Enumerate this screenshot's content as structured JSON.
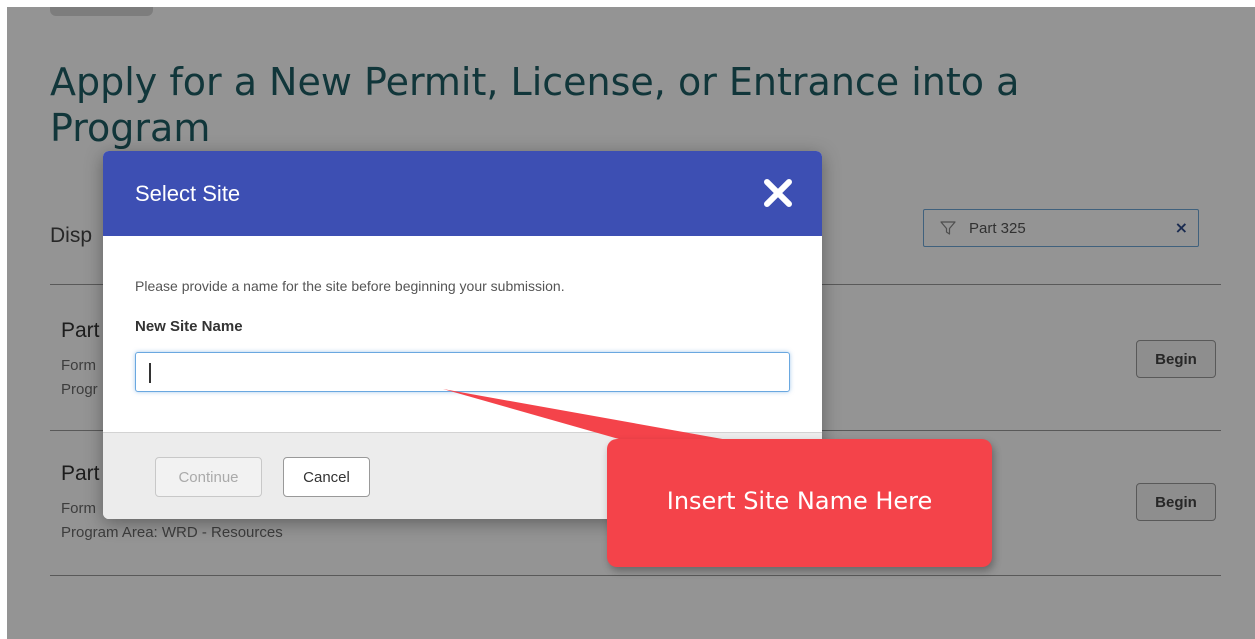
{
  "page": {
    "title": "Apply for a New Permit, License, or Entrance into a Program",
    "display_label": "Disp"
  },
  "filter": {
    "value": "Part 325",
    "clear_label": "×"
  },
  "rows": [
    {
      "title": "Part",
      "meta_lines": [
        "Form",
        "Progr"
      ],
      "button_label": "Begin"
    },
    {
      "title": "Part",
      "meta_lines": [
        "Form",
        "Program Area: WRD - Resources"
      ],
      "button_label": "Begin"
    }
  ],
  "modal": {
    "title": "Select Site",
    "close_icon": "close-icon",
    "instruction": "Please provide a name for the site before beginning your submission.",
    "field_label": "New Site Name",
    "input_value": "",
    "continue_label": "Continue",
    "cancel_label": "Cancel"
  },
  "callout": {
    "text": "Insert Site Name Here",
    "color": "#f4434a"
  },
  "colors": {
    "modal_header": "#3d4fb3",
    "title_text": "#1e5e64",
    "input_focus": "#6aa8e0"
  }
}
